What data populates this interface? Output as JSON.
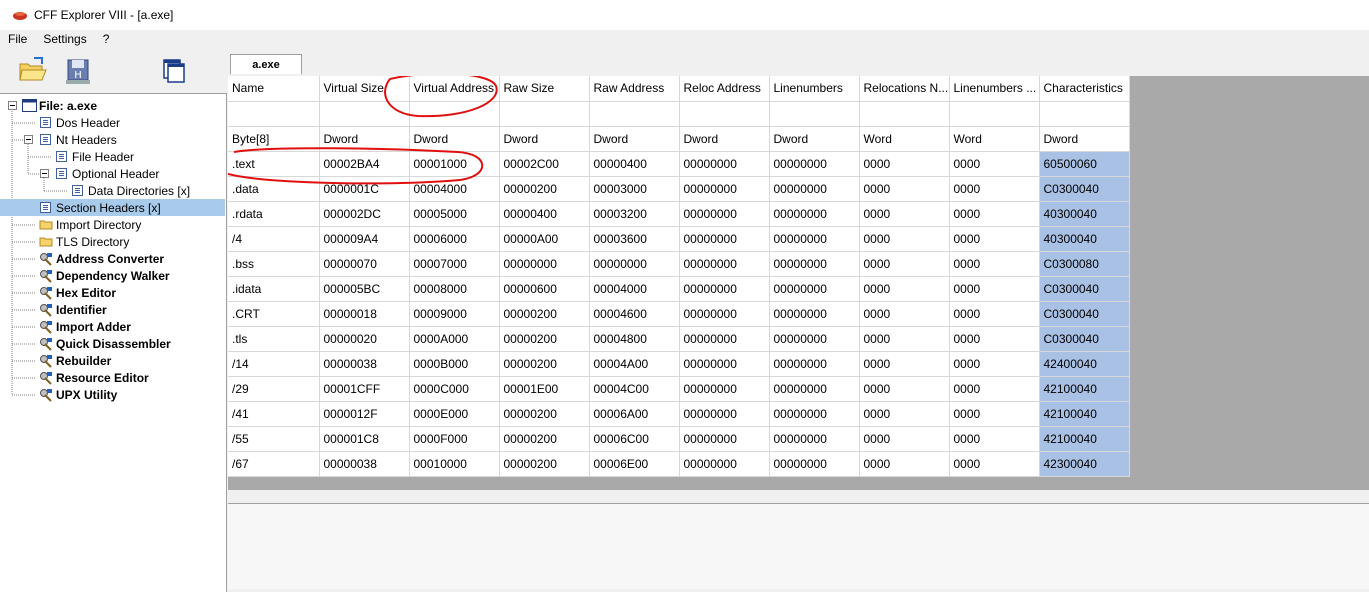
{
  "window": {
    "title": "CFF Explorer VIII - [a.exe]"
  },
  "menu": [
    "File",
    "Settings",
    "?"
  ],
  "toolbar": {
    "buttons": [
      "open-file-icon",
      "save-disk-icon",
      "windows-icon"
    ]
  },
  "tree": {
    "items": [
      {
        "label": "File: a.exe",
        "level": 0,
        "icon": "file-window-icon",
        "bold": true
      },
      {
        "label": "Dos Header",
        "level": 1,
        "icon": "doc-icon"
      },
      {
        "label": "Nt Headers",
        "level": 1,
        "icon": "doc-icon"
      },
      {
        "label": "File Header",
        "level": 2,
        "icon": "doc-icon"
      },
      {
        "label": "Optional Header",
        "level": 2,
        "icon": "doc-icon"
      },
      {
        "label": "Data Directories [x]",
        "level": 3,
        "icon": "doc-icon"
      },
      {
        "label": "Section Headers [x]",
        "level": 1,
        "icon": "doc-icon",
        "selected": true
      },
      {
        "label": "Import Directory",
        "level": 1,
        "icon": "folder-icon"
      },
      {
        "label": "TLS Directory",
        "level": 1,
        "icon": "folder-icon"
      },
      {
        "label": "Address Converter",
        "level": 1,
        "icon": "tool-icon",
        "bold": true
      },
      {
        "label": "Dependency Walker",
        "level": 1,
        "icon": "tool-icon",
        "bold": true
      },
      {
        "label": "Hex Editor",
        "level": 1,
        "icon": "tool-icon",
        "bold": true
      },
      {
        "label": "Identifier",
        "level": 1,
        "icon": "tool-icon",
        "bold": true
      },
      {
        "label": "Import Adder",
        "level": 1,
        "icon": "tool-icon",
        "bold": true
      },
      {
        "label": "Quick Disassembler",
        "level": 1,
        "icon": "tool-icon",
        "bold": true
      },
      {
        "label": "Rebuilder",
        "level": 1,
        "icon": "tool-icon",
        "bold": true
      },
      {
        "label": "Resource Editor",
        "level": 1,
        "icon": "tool-icon",
        "bold": true
      },
      {
        "label": "UPX Utility",
        "level": 1,
        "icon": "tool-icon",
        "bold": true
      }
    ]
  },
  "tab": {
    "label": "a.exe"
  },
  "table": {
    "columns": [
      "Name",
      "Virtual Size",
      "Virtual Address",
      "Raw Size",
      "Raw Address",
      "Reloc Address",
      "Linenumbers",
      "Relocations N...",
      "Linenumbers ...",
      "Characteristics"
    ],
    "types": [
      "Byte[8]",
      "Dword",
      "Dword",
      "Dword",
      "Dword",
      "Dword",
      "Dword",
      "Word",
      "Word",
      "Dword"
    ],
    "rows": [
      [
        ".text",
        "00002BA4",
        "00001000",
        "00002C00",
        "00000400",
        "00000000",
        "00000000",
        "0000",
        "0000",
        "60500060"
      ],
      [
        ".data",
        "0000001C",
        "00004000",
        "00000200",
        "00003000",
        "00000000",
        "00000000",
        "0000",
        "0000",
        "C0300040"
      ],
      [
        ".rdata",
        "000002DC",
        "00005000",
        "00000400",
        "00003200",
        "00000000",
        "00000000",
        "0000",
        "0000",
        "40300040"
      ],
      [
        "/4",
        "000009A4",
        "00006000",
        "00000A00",
        "00003600",
        "00000000",
        "00000000",
        "0000",
        "0000",
        "40300040"
      ],
      [
        ".bss",
        "00000070",
        "00007000",
        "00000000",
        "00000000",
        "00000000",
        "00000000",
        "0000",
        "0000",
        "C0300080"
      ],
      [
        ".idata",
        "000005BC",
        "00008000",
        "00000600",
        "00004000",
        "00000000",
        "00000000",
        "0000",
        "0000",
        "C0300040"
      ],
      [
        ".CRT",
        "00000018",
        "00009000",
        "00000200",
        "00004600",
        "00000000",
        "00000000",
        "0000",
        "0000",
        "C0300040"
      ],
      [
        ".tls",
        "00000020",
        "0000A000",
        "00000200",
        "00004800",
        "00000000",
        "00000000",
        "0000",
        "0000",
        "C0300040"
      ],
      [
        "/14",
        "00000038",
        "0000B000",
        "00000200",
        "00004A00",
        "00000000",
        "00000000",
        "0000",
        "0000",
        "42400040"
      ],
      [
        "/29",
        "00001CFF",
        "0000C000",
        "00001E00",
        "00004C00",
        "00000000",
        "00000000",
        "0000",
        "0000",
        "42100040"
      ],
      [
        "/41",
        "0000012F",
        "0000E000",
        "00000200",
        "00006A00",
        "00000000",
        "00000000",
        "0000",
        "0000",
        "42100040"
      ],
      [
        "/55",
        "000001C8",
        "0000F000",
        "00000200",
        "00006C00",
        "00000000",
        "00000000",
        "0000",
        "0000",
        "42100040"
      ],
      [
        "/67",
        "00000038",
        "00010000",
        "00000200",
        "00006E00",
        "00000000",
        "00000000",
        "0000",
        "0000",
        "42300040"
      ]
    ]
  },
  "colors": {
    "selection": "#a8cbeb",
    "characteristics_column": "#a9c1e4",
    "annotation": "#e01010"
  }
}
